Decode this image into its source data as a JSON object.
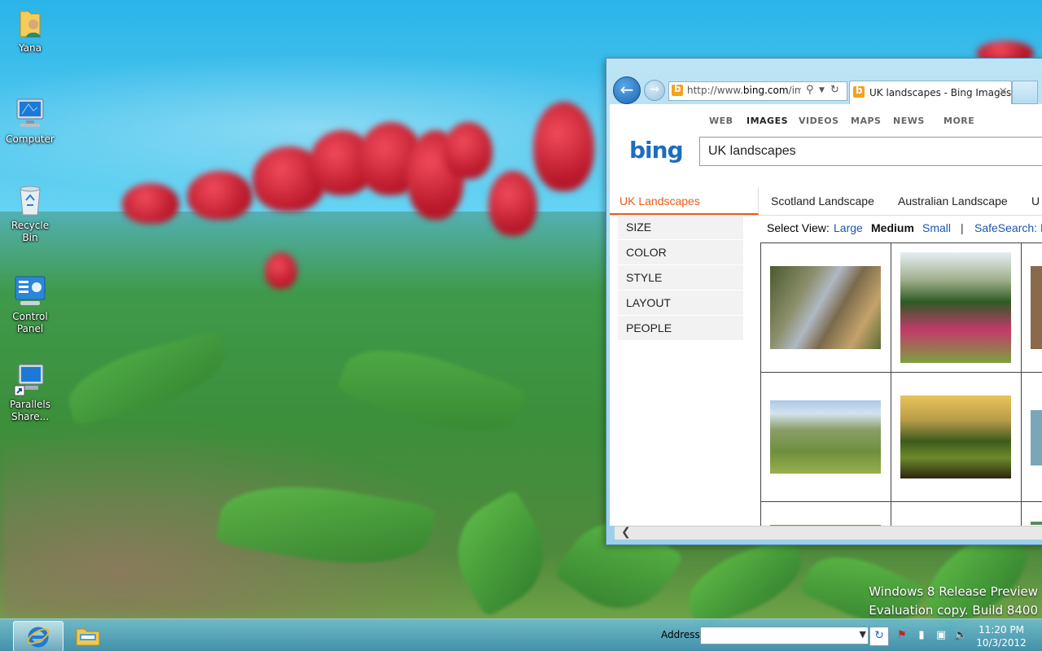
{
  "desktop": {
    "icons": [
      {
        "label": "Yana",
        "icon": "user-folder-icon"
      },
      {
        "label": "Computer",
        "icon": "computer-icon"
      },
      {
        "label": "Recycle Bin",
        "icon": "recycle-bin-icon"
      },
      {
        "label": "Control Panel",
        "icon": "control-panel-icon"
      },
      {
        "label": "Parallels Share...",
        "icon": "parallels-share-icon"
      }
    ],
    "watermark": {
      "line1": "Windows 8 Release Preview",
      "line2": "Evaluation copy. Build 8400"
    }
  },
  "taskbar": {
    "address_label": "Address",
    "address_value": "",
    "clock_time": "11:20 PM",
    "clock_date": "10/3/2012",
    "pinned": [
      {
        "name": "internet-explorer-icon",
        "active": true
      },
      {
        "name": "file-explorer-icon",
        "active": false
      }
    ]
  },
  "browser": {
    "url_prefix": "http://www.",
    "url_domain": "bing.com",
    "url_rest": "/ima",
    "tab_title": "UK landscapes - Bing Images",
    "nav": [
      "WEB",
      "IMAGES",
      "VIDEOS",
      "MAPS",
      "NEWS",
      "MORE"
    ],
    "nav_active": "IMAGES",
    "logo": "bing",
    "query": "UK landscapes",
    "related": [
      "UK Landscapes",
      "Scotland Landscape",
      "Australian Landscape",
      "U"
    ],
    "filters": [
      "SIZE",
      "COLOR",
      "STYLE",
      "LAYOUT",
      "PEOPLE"
    ],
    "view": {
      "label": "Select View:",
      "large": "Large",
      "medium": "Medium",
      "small": "Small",
      "separator": "|",
      "safesearch": "SafeSearch: M"
    }
  }
}
